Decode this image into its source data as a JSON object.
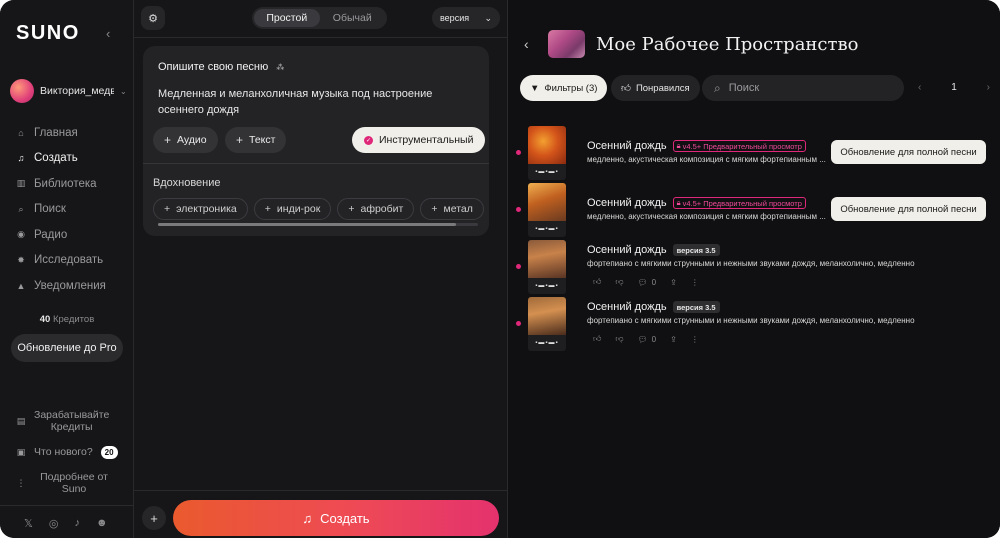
{
  "sidebar": {
    "logo": "SUNO",
    "collapse_icon": "chevron-left-icon",
    "user_name": "Виктория_медв",
    "nav": [
      {
        "label": "Главная",
        "icon": "home-icon",
        "glyph": "⌂"
      },
      {
        "label": "Создать",
        "icon": "music-note-icon",
        "glyph": "♫"
      },
      {
        "label": "Библиотека",
        "icon": "library-icon",
        "glyph": "▥"
      },
      {
        "label": "Поиск",
        "icon": "search-icon",
        "glyph": "⌕"
      },
      {
        "label": "Радио",
        "icon": "radio-icon",
        "glyph": "◉"
      },
      {
        "label": "Исследовать",
        "icon": "explore-icon",
        "glyph": "✸"
      },
      {
        "label": "Уведомления",
        "icon": "bell-icon",
        "glyph": "▲"
      }
    ],
    "credits_count": "40",
    "credits_label": "Кредитов",
    "upgrade_label": "Обновление до Pro",
    "earn_label_1": "Зарабатывайте",
    "earn_label_2": "Кредиты",
    "whats_new_label": "Что нового?",
    "whats_new_count": "20",
    "more_label_1": "Подробнее от",
    "more_label_2": "Suno"
  },
  "composer": {
    "mode_simple": "Простой",
    "mode_custom": "Обычай",
    "version_label": "версия",
    "describe_label": "Опишите свою песню",
    "prompt": "Медленная и меланхоличная музыка под настроение осеннего дождя",
    "audio_label": "Аудио",
    "lyrics_label": "Текст",
    "instrumental_label": "Инструментальный",
    "inspiration_label": "Вдохновение",
    "tags": [
      "электроника",
      "инди-рок",
      "афробит",
      "метал"
    ],
    "create_label": "Создать"
  },
  "workspace": {
    "title": "Мое Рабочее Пространство",
    "filters_label": "Фильтры (3)",
    "liked_label": "Понравился",
    "search_placeholder": "Поиск",
    "page": "1",
    "songs": [
      {
        "title": "Осенний дождь",
        "badge": "v4.5+ Предварительный просмотр",
        "desc": "медленно, акустическая композиция с мягким фортепианным ...",
        "upgrade": "Обновление для полной песни"
      },
      {
        "title": "Осенний дождь",
        "badge": "v4.5+ Предварительный просмотр",
        "desc": "медленно, акустическая композиция с мягким фортепианным ...",
        "upgrade": "Обновление для полной песни"
      },
      {
        "title": "Осенний дождь",
        "version": "версия 3.5",
        "desc": "фортепиано с мягкими струнными и нежными звуками дождя, меланхолично, медленно",
        "comments": "0"
      },
      {
        "title": "Осенний дождь",
        "version": "версия 3.5",
        "desc": "фортепиано с мягкими струнными и нежными звуками дождя, меланхолично, медленно",
        "comments": "0"
      }
    ]
  },
  "colors": {
    "accent_pink": "#e0287a",
    "create_gradient_start": "#ea5a2e",
    "create_gradient_end": "#e4326e",
    "background": "#101012"
  }
}
